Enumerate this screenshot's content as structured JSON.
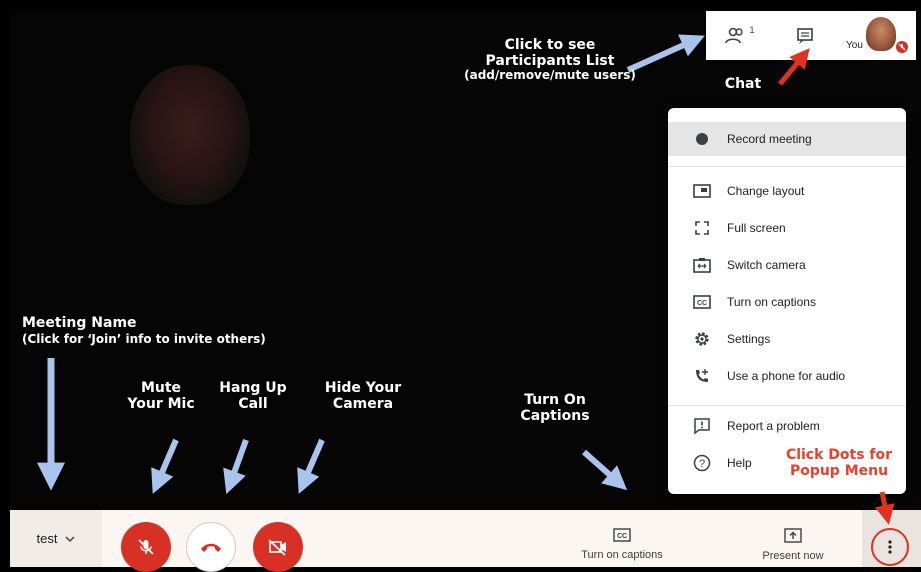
{
  "top_bar": {
    "participants_count": "1",
    "you_label": "You"
  },
  "menu": {
    "items": [
      {
        "label": "Record meeting",
        "icon": "record-dot-icon"
      },
      {
        "label": "Change layout",
        "icon": "layout-icon"
      },
      {
        "label": "Full screen",
        "icon": "fullscreen-icon"
      },
      {
        "label": "Switch camera",
        "icon": "switch-camera-icon"
      },
      {
        "label": "Turn on captions",
        "icon": "captions-icon"
      },
      {
        "label": "Settings",
        "icon": "gear-icon"
      },
      {
        "label": "Use a phone for audio",
        "icon": "phone-icon"
      },
      {
        "label": "Report a problem",
        "icon": "report-icon"
      },
      {
        "label": "Help",
        "icon": "help-icon"
      }
    ]
  },
  "bottom_bar": {
    "meeting_name": "test",
    "captions_label": "Turn on captions",
    "present_label": "Present now"
  },
  "annotations": {
    "participants_line1": "Click to see",
    "participants_line2": "Participants List",
    "participants_line3": "(add/remove/mute users)",
    "chat": "Chat",
    "meeting_name_line1": "Meeting Name",
    "meeting_name_line2": "(Click for ‘Join’ info to invite others)",
    "mute_line1": "Mute",
    "mute_line2": "Your Mic",
    "hangup_line1": "Hang Up",
    "hangup_line2": "Call",
    "hide_line1": "Hide Your",
    "hide_line2": "Camera",
    "captions_line1": "Turn On",
    "captions_line2": "Captions",
    "dots_line1": "Click Dots for",
    "dots_line2": "Popup Menu"
  },
  "colors": {
    "accent_red": "#d93025",
    "annotation_red": "#e8402a",
    "arrow_blue": "#a9c4ec",
    "arrow_red": "#e0321f"
  }
}
